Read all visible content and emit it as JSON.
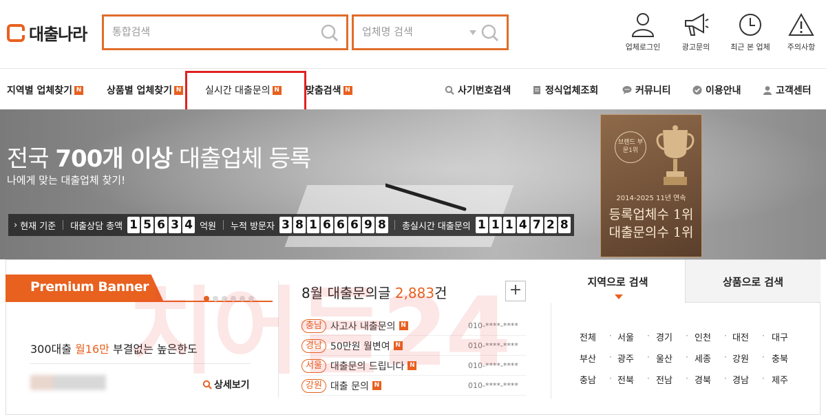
{
  "header": {
    "logo_text": "대출나라",
    "search_placeholder": "통합검색",
    "company_search_placeholder": "업체명 검색",
    "icons": [
      {
        "label": "업체로그인",
        "icon": "person-icon"
      },
      {
        "label": "광고문의",
        "icon": "megaphone-icon"
      },
      {
        "label": "최근 본 업체",
        "icon": "clock-icon"
      },
      {
        "label": "주의사항",
        "icon": "warning-icon"
      }
    ]
  },
  "nav": {
    "left": [
      {
        "label": "지역별 업체찾기",
        "badge": "N"
      },
      {
        "label": "상품별 업체찾기",
        "badge": "N"
      },
      {
        "label": "실시간 대출문의",
        "badge": "N"
      },
      {
        "label": "맞춤검색",
        "badge": "N"
      }
    ],
    "right": [
      {
        "label": "사기번호검색",
        "icon": "search-icon"
      },
      {
        "label": "정식업체조회",
        "icon": "document-icon"
      },
      {
        "label": "커뮤니티",
        "icon": "chat-icon"
      },
      {
        "label": "이용안내",
        "icon": "check-icon"
      },
      {
        "label": "고객센터",
        "icon": "person-icon"
      }
    ]
  },
  "hero": {
    "title_prefix": "전국 ",
    "title_bold": "700개 이상",
    "title_suffix": " 대출업체 등록",
    "subtitle": "나에게 맞는 대출업체 찾기!",
    "stats": {
      "now_label": "현재 기준",
      "consult_label": "대출상담 총액",
      "consult_digits": [
        "1",
        "5",
        "6",
        "3",
        "4"
      ],
      "consult_unit": "억원",
      "visitors_label": "누적 방문자",
      "visitors_digits": [
        "3",
        "8",
        "1",
        "6",
        "6",
        "6",
        "9",
        "8"
      ],
      "inquiries_label": "총실시간 대출문의",
      "inquiries_digits": [
        "1",
        "1",
        "1",
        "4",
        "7",
        "2",
        "8"
      ]
    },
    "award": {
      "seal": "브랜드 부문1위",
      "since": "2014-2025 11년 연속",
      "line1": "등록업체수 1위",
      "line2": "대출문의수 1위"
    }
  },
  "promo": {
    "tab_label": "Premium Banner",
    "text_prefix": "300대출 ",
    "text_highlight": "월16만",
    "text_suffix": " 부결없는 높은한도",
    "detail_label": "상세보기"
  },
  "inquiries": {
    "title_prefix": "8월 대출문의글 ",
    "count": "2,883",
    "title_suffix": "건",
    "plus": "+",
    "rows": [
      {
        "region": "충남",
        "text": "사고사 내출문의",
        "badge": "N",
        "phone": "010-****-****"
      },
      {
        "region": "경남",
        "text": "50만원 월변여",
        "badge": "N",
        "phone": "010-****-****"
      },
      {
        "region": "서울",
        "text": "대출문의 드립니다",
        "badge": "N",
        "phone": "010-****-****"
      },
      {
        "region": "강원",
        "text": "대출 문의",
        "badge": "N",
        "phone": "010-****-****"
      }
    ]
  },
  "search_tabs": {
    "region_tab": "지역으로 검색",
    "product_tab": "상품으로 검색",
    "regions": [
      [
        "전체",
        "서울",
        "경기",
        "인천",
        "대전",
        "대구"
      ],
      [
        "부산",
        "광주",
        "울산",
        "세종",
        "강원",
        "충북"
      ],
      [
        "충남",
        "전북",
        "전남",
        "경북",
        "경남",
        "제주"
      ]
    ]
  },
  "watermark": "치어들24",
  "colors": {
    "accent": "#e8611f",
    "highlight_box": "#e02020"
  }
}
